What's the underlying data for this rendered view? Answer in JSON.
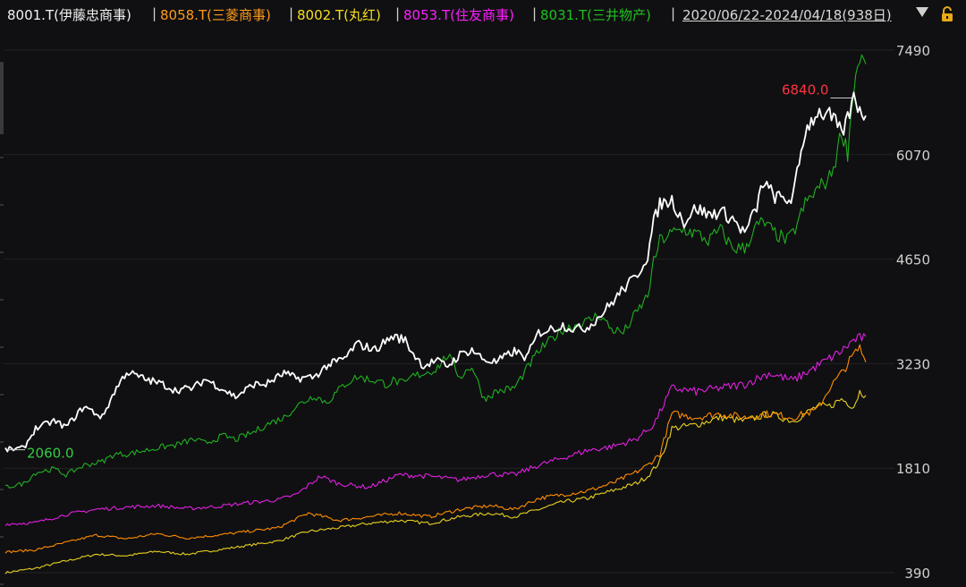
{
  "header": {
    "stocks": [
      {
        "label": "8001.T(伊藤忠商事)",
        "color": "#f2f2f2"
      },
      {
        "label": "8058.T(三菱商事)",
        "color": "#ff9a1a"
      },
      {
        "label": "8002.T(丸红)",
        "color": "#f7df1e"
      },
      {
        "label": "8053.T(住友商事)",
        "color": "#ff1fff"
      },
      {
        "label": "8031.T(三井物产)",
        "color": "#20c020"
      }
    ],
    "separator": "|",
    "date_range": "2020/06/22-2024/04/18(938日)"
  },
  "chart_data": {
    "type": "line",
    "x_range": [
      "2020/06/22",
      "2024/04/18"
    ],
    "trading_days": 938,
    "yticks": [
      390,
      1810,
      3230,
      4650,
      6070,
      7490
    ],
    "ylim": [
      300,
      7700
    ],
    "grid": true,
    "annotations": [
      {
        "text": "6840.0",
        "series": "8001.T(伊藤忠商事)",
        "at": "max",
        "color": "#ff3344"
      },
      {
        "text": "2060.0",
        "series": "8001.T(伊藤忠商事)",
        "at": "min",
        "color": "#33cc44"
      }
    ],
    "series": [
      {
        "name": "8001.T(伊藤忠商事)",
        "color": "#ffffff",
        "points": [
          [
            0,
            2060
          ],
          [
            3,
            2080
          ],
          [
            5,
            2350
          ],
          [
            8,
            2450
          ],
          [
            10,
            2370
          ],
          [
            13,
            2650
          ],
          [
            16,
            2500
          ],
          [
            18,
            2850
          ],
          [
            20,
            3120
          ],
          [
            23,
            3020
          ],
          [
            26,
            2950
          ],
          [
            28,
            2870
          ],
          [
            31,
            2900
          ],
          [
            33,
            3020
          ],
          [
            36,
            2880
          ],
          [
            38,
            2780
          ],
          [
            41,
            2950
          ],
          [
            43,
            2950
          ],
          [
            46,
            3100
          ],
          [
            48,
            3030
          ],
          [
            51,
            3050
          ],
          [
            53,
            3200
          ],
          [
            56,
            3300
          ],
          [
            58,
            3500
          ],
          [
            61,
            3420
          ],
          [
            63,
            3550
          ],
          [
            64,
            3600
          ],
          [
            66,
            3550
          ],
          [
            67,
            3400
          ],
          [
            69,
            3200
          ],
          [
            71,
            3270
          ],
          [
            73,
            3200
          ],
          [
            75,
            3350
          ],
          [
            77,
            3420
          ],
          [
            79,
            3280
          ],
          [
            81,
            3250
          ],
          [
            84,
            3400
          ],
          [
            86,
            3310
          ],
          [
            88,
            3650
          ],
          [
            90,
            3700
          ],
          [
            92,
            3750
          ],
          [
            94,
            3700
          ],
          [
            96,
            3720
          ],
          [
            98,
            3870
          ],
          [
            100,
            4050
          ],
          [
            102,
            4250
          ],
          [
            104,
            4400
          ],
          [
            106,
            4700
          ],
          [
            107,
            5150
          ],
          [
            108,
            5400
          ],
          [
            110,
            5450
          ],
          [
            112,
            5150
          ],
          [
            114,
            5350
          ],
          [
            116,
            5250
          ],
          [
            118,
            5300
          ],
          [
            120,
            5200
          ],
          [
            122,
            5000
          ],
          [
            124,
            5350
          ],
          [
            125,
            5700
          ],
          [
            127,
            5500
          ],
          [
            129,
            5450
          ],
          [
            130,
            5500
          ],
          [
            132,
            6400
          ],
          [
            134,
            6650
          ],
          [
            136,
            6600
          ],
          [
            137,
            6500
          ],
          [
            138,
            6350
          ],
          [
            139,
            6550
          ],
          [
            140,
            6840
          ],
          [
            141,
            6700
          ],
          [
            142,
            6600
          ]
        ]
      },
      {
        "name": "8031.T(三井物产)",
        "color": "#20b020",
        "points": [
          [
            0,
            1550
          ],
          [
            3,
            1600
          ],
          [
            5,
            1750
          ],
          [
            8,
            1800
          ],
          [
            10,
            1720
          ],
          [
            13,
            1850
          ],
          [
            16,
            1900
          ],
          [
            18,
            2000
          ],
          [
            20,
            2000
          ],
          [
            23,
            2050
          ],
          [
            26,
            2100
          ],
          [
            28,
            2120
          ],
          [
            31,
            2200
          ],
          [
            33,
            2150
          ],
          [
            36,
            2250
          ],
          [
            38,
            2200
          ],
          [
            41,
            2300
          ],
          [
            43,
            2400
          ],
          [
            46,
            2500
          ],
          [
            48,
            2650
          ],
          [
            51,
            2800
          ],
          [
            53,
            2700
          ],
          [
            56,
            2950
          ],
          [
            58,
            3050
          ],
          [
            61,
            3000
          ],
          [
            63,
            2950
          ],
          [
            64,
            3000
          ],
          [
            66,
            2950
          ],
          [
            67,
            3050
          ],
          [
            69,
            3100
          ],
          [
            71,
            3150
          ],
          [
            73,
            3350
          ],
          [
            75,
            3050
          ],
          [
            77,
            3200
          ],
          [
            79,
            2750
          ],
          [
            81,
            2850
          ],
          [
            84,
            2900
          ],
          [
            86,
            3150
          ],
          [
            88,
            3400
          ],
          [
            90,
            3550
          ],
          [
            92,
            3700
          ],
          [
            94,
            3750
          ],
          [
            96,
            3800
          ],
          [
            98,
            3900
          ],
          [
            100,
            3700
          ],
          [
            102,
            3650
          ],
          [
            104,
            3900
          ],
          [
            106,
            4150
          ],
          [
            107,
            4600
          ],
          [
            108,
            4900
          ],
          [
            110,
            5000
          ],
          [
            112,
            5050
          ],
          [
            114,
            5000
          ],
          [
            116,
            4900
          ],
          [
            118,
            5050
          ],
          [
            120,
            4800
          ],
          [
            122,
            4800
          ],
          [
            124,
            5100
          ],
          [
            125,
            5150
          ],
          [
            127,
            5000
          ],
          [
            129,
            4900
          ],
          [
            130,
            5000
          ],
          [
            132,
            5400
          ],
          [
            134,
            5600
          ],
          [
            136,
            5750
          ],
          [
            137,
            6000
          ],
          [
            138,
            6400
          ],
          [
            139,
            6100
          ],
          [
            140,
            7000
          ],
          [
            141,
            7400
          ],
          [
            142,
            7300
          ]
        ]
      },
      {
        "name": "8053.T(住友商事)",
        "color": "#e020e0",
        "points": [
          [
            0,
            1050
          ],
          [
            5,
            1070
          ],
          [
            10,
            1180
          ],
          [
            15,
            1250
          ],
          [
            20,
            1280
          ],
          [
            25,
            1300
          ],
          [
            30,
            1260
          ],
          [
            35,
            1290
          ],
          [
            40,
            1340
          ],
          [
            45,
            1380
          ],
          [
            48,
            1450
          ],
          [
            52,
            1700
          ],
          [
            55,
            1600
          ],
          [
            60,
            1550
          ],
          [
            65,
            1720
          ],
          [
            70,
            1700
          ],
          [
            75,
            1650
          ],
          [
            80,
            1730
          ],
          [
            84,
            1720
          ],
          [
            88,
            1850
          ],
          [
            92,
            1950
          ],
          [
            96,
            2050
          ],
          [
            100,
            2100
          ],
          [
            104,
            2200
          ],
          [
            107,
            2400
          ],
          [
            110,
            2900
          ],
          [
            114,
            2850
          ],
          [
            118,
            2900
          ],
          [
            122,
            2950
          ],
          [
            126,
            3100
          ],
          [
            130,
            3000
          ],
          [
            134,
            3200
          ],
          [
            138,
            3400
          ],
          [
            140,
            3550
          ],
          [
            142,
            3600
          ]
        ]
      },
      {
        "name": "8058.T(三菱商事)",
        "color": "#ff8c00",
        "points": [
          [
            0,
            670
          ],
          [
            5,
            700
          ],
          [
            10,
            800
          ],
          [
            15,
            900
          ],
          [
            20,
            850
          ],
          [
            25,
            920
          ],
          [
            30,
            860
          ],
          [
            35,
            900
          ],
          [
            40,
            950
          ],
          [
            45,
            1000
          ],
          [
            50,
            1200
          ],
          [
            55,
            1100
          ],
          [
            60,
            1150
          ],
          [
            65,
            1200
          ],
          [
            70,
            1150
          ],
          [
            75,
            1250
          ],
          [
            80,
            1300
          ],
          [
            84,
            1250
          ],
          [
            88,
            1400
          ],
          [
            92,
            1450
          ],
          [
            96,
            1500
          ],
          [
            100,
            1600
          ],
          [
            104,
            1750
          ],
          [
            106,
            1850
          ],
          [
            108,
            2000
          ],
          [
            110,
            2550
          ],
          [
            114,
            2500
          ],
          [
            118,
            2550
          ],
          [
            122,
            2500
          ],
          [
            126,
            2550
          ],
          [
            130,
            2500
          ],
          [
            134,
            2600
          ],
          [
            136,
            2900
          ],
          [
            138,
            3100
          ],
          [
            140,
            3350
          ],
          [
            141,
            3450
          ],
          [
            142,
            3250
          ]
        ]
      },
      {
        "name": "8002.T(丸红)",
        "color": "#e8d020",
        "points": [
          [
            0,
            390
          ],
          [
            5,
            450
          ],
          [
            10,
            550
          ],
          [
            15,
            640
          ],
          [
            20,
            620
          ],
          [
            25,
            680
          ],
          [
            30,
            640
          ],
          [
            35,
            700
          ],
          [
            40,
            760
          ],
          [
            45,
            820
          ],
          [
            50,
            950
          ],
          [
            55,
            1000
          ],
          [
            60,
            1060
          ],
          [
            65,
            1100
          ],
          [
            70,
            1060
          ],
          [
            75,
            1150
          ],
          [
            80,
            1200
          ],
          [
            84,
            1150
          ],
          [
            88,
            1250
          ],
          [
            92,
            1350
          ],
          [
            96,
            1400
          ],
          [
            100,
            1500
          ],
          [
            104,
            1600
          ],
          [
            106,
            1700
          ],
          [
            108,
            1900
          ],
          [
            110,
            2350
          ],
          [
            114,
            2400
          ],
          [
            118,
            2500
          ],
          [
            122,
            2450
          ],
          [
            126,
            2550
          ],
          [
            130,
            2450
          ],
          [
            134,
            2650
          ],
          [
            136,
            2650
          ],
          [
            138,
            2750
          ],
          [
            140,
            2650
          ],
          [
            141,
            2850
          ],
          [
            142,
            2800
          ]
        ]
      }
    ]
  }
}
